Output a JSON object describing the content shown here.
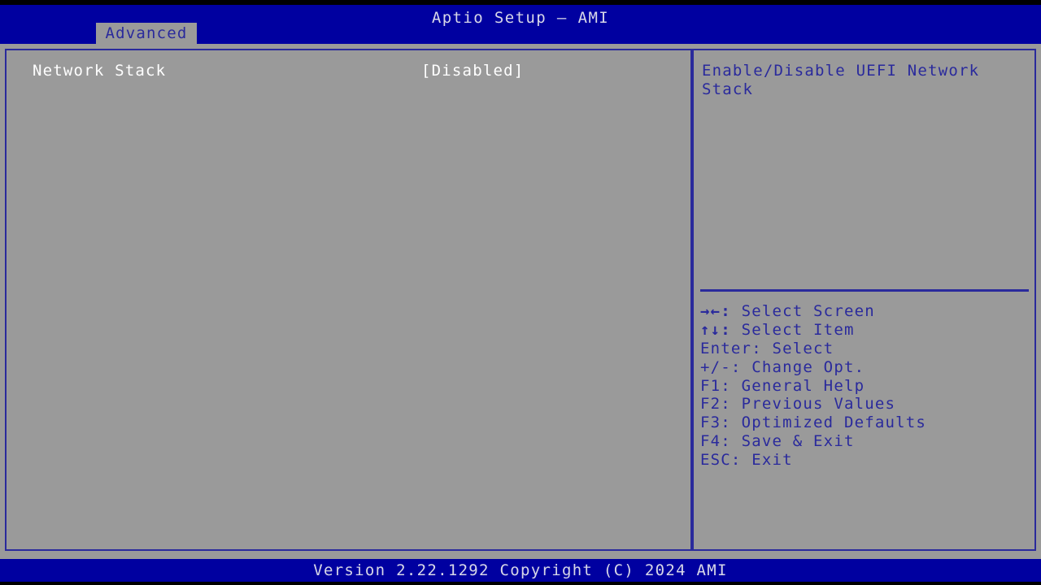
{
  "window": {
    "title": "Aptio Setup – AMI",
    "colors": {
      "title_bar": "#0000a0",
      "panel_bg": "#9a9a9a",
      "border": "#2a2a9c",
      "help_text": "#2a2a9c",
      "setting_text": "#ffffff",
      "footer_bar": "#0000a0",
      "footer_text": "#d8d8e8"
    }
  },
  "tabs": [
    {
      "label": "Advanced",
      "selected": true
    }
  ],
  "main": {
    "settings": [
      {
        "label": "Network Stack",
        "value": "[Disabled]",
        "selected": true
      }
    ]
  },
  "help": {
    "description": "Enable/Disable UEFI Network\nStack",
    "legend": [
      {
        "key": "→←:",
        "icon": "arrow-left-right-icon",
        "action": "Select Screen"
      },
      {
        "key": "↑↓:",
        "icon": "arrow-up-down-icon",
        "action": "Select Item"
      },
      {
        "key": "Enter:",
        "icon": "enter-key-icon",
        "action": "Select"
      },
      {
        "key": "+/-:",
        "icon": "plus-minus-key-icon",
        "action": "Change Opt."
      },
      {
        "key": "F1:",
        "icon": "f1-key-icon",
        "action": "General Help"
      },
      {
        "key": "F2:",
        "icon": "f2-key-icon",
        "action": "Previous Values"
      },
      {
        "key": "F3:",
        "icon": "f3-key-icon",
        "action": "Optimized Defaults"
      },
      {
        "key": "F4:",
        "icon": "f4-key-icon",
        "action": "Save & Exit"
      },
      {
        "key": "ESC:",
        "icon": "esc-key-icon",
        "action": "Exit"
      }
    ]
  },
  "footer": {
    "version_text": "Version 2.22.1292 Copyright (C) 2024 AMI"
  }
}
